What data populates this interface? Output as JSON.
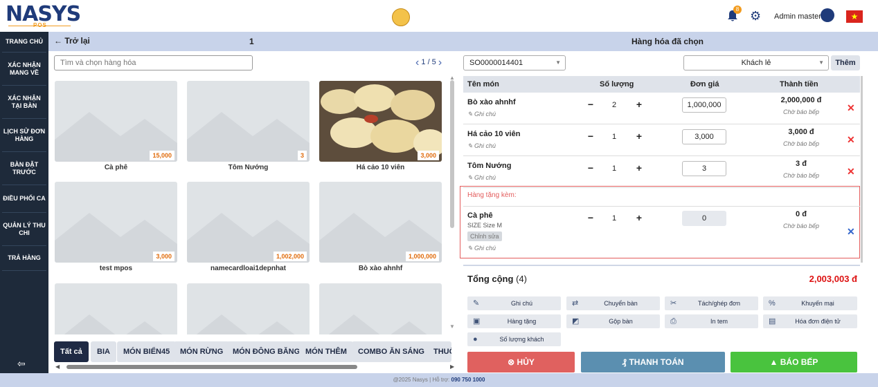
{
  "header": {
    "brand": "NASYS",
    "brand_sub": "POS",
    "notification_count": "8",
    "user_name": "Admin master"
  },
  "sidebar": {
    "items": [
      {
        "label": "TRANG CHỦ"
      },
      {
        "label": "XÁC NHẬN MANG VỀ"
      },
      {
        "label": "XÁC NHẬN TẠI BÀN"
      },
      {
        "label": "LỊCH SỬ ĐƠN HÀNG"
      },
      {
        "label": "BÀN ĐẶT TRƯỚC"
      },
      {
        "label": "ĐIỀU PHỐI CA"
      },
      {
        "label": "QUẢN LÝ THU CHI"
      },
      {
        "label": "TRẢ HÀNG"
      }
    ]
  },
  "left": {
    "back_label": "← Trở lại",
    "table_number": "1",
    "search_placeholder": "Tìm và chọn hàng hóa",
    "pager": "1 / 5"
  },
  "products": [
    {
      "name": "Cà phê",
      "price": "15,000",
      "has_image": false
    },
    {
      "name": "Tôm Nướng",
      "price": "3",
      "has_image": false
    },
    {
      "name": "Há cảo 10 viên",
      "price": "3,000",
      "has_image": true
    },
    {
      "name": "test mpos",
      "price": "3,000",
      "has_image": false
    },
    {
      "name": "namecardloai1depnhat",
      "price": "1,002,000",
      "has_image": false
    },
    {
      "name": "Bò xào ahnhf",
      "price": "1,000,000",
      "has_image": false
    },
    {
      "name": "",
      "price": "",
      "has_image": false
    },
    {
      "name": "",
      "price": "",
      "has_image": false
    },
    {
      "name": "",
      "price": "",
      "has_image": false
    }
  ],
  "categories": [
    {
      "label": "Tất cả",
      "active": true
    },
    {
      "label": "BIA"
    },
    {
      "label": "MÓN BIỂN45"
    },
    {
      "label": "MÓN RỪNG"
    },
    {
      "label": "MÓN ĐÔNG BĂNG"
    },
    {
      "label": "MÓN THÊM"
    },
    {
      "label": "COMBO ĂN SÁNG"
    },
    {
      "label": "THUỐ"
    }
  ],
  "right": {
    "title": "Hàng hóa đã chọn",
    "order_code": "SO0000014401",
    "customer": "Khách lẻ",
    "add_label": "Thêm",
    "columns": {
      "name": "Tên món",
      "qty": "Số lượng",
      "price": "Đơn giá",
      "total": "Thành tiền"
    },
    "note_label": "Ghi chú",
    "status_label": "Chờ báo bếp",
    "items": [
      {
        "name": "Bò xào ahnhf",
        "qty": "2",
        "price": "1,000,000",
        "total": "2,000,000 đ"
      },
      {
        "name": "Há cảo 10 viên",
        "qty": "1",
        "price": "3,000",
        "total": "3,000 đ"
      },
      {
        "name": "Tôm Nướng",
        "qty": "1",
        "price": "3",
        "total": "3 đ"
      }
    ],
    "gift_label": "Hàng tặng kèm:",
    "gift": {
      "name": "Cà phê",
      "size": "SIZE Size M",
      "edit_label": "Chỉnh sửa",
      "qty": "1",
      "price": "0",
      "total": "0 đ"
    },
    "sum_label": "Tổng cộng",
    "sum_count": "(4)",
    "sum_value": "2,003,003 đ",
    "actions": [
      {
        "label": "Ghi chú",
        "icon": "pencil-icon"
      },
      {
        "label": "Chuyển bàn",
        "icon": "swap-icon"
      },
      {
        "label": "Tách/ghép đơn",
        "icon": "scissors-icon"
      },
      {
        "label": "Khuyến mại",
        "icon": "discount-icon"
      },
      {
        "label": "Hàng tặng",
        "icon": "gift-icon"
      },
      {
        "label": "Gộp bàn",
        "icon": "merge-icon"
      },
      {
        "label": "In tem",
        "icon": "printer-icon"
      },
      {
        "label": "Hóa đơn điện tử",
        "icon": "invoice-icon"
      },
      {
        "label": "Số lượng khách",
        "icon": "person-icon"
      }
    ],
    "cancel_label": "HỦY",
    "pay_label": "THANH TOÁN",
    "kitchen_label": "BÁO BẾP"
  },
  "colors": {
    "primary": "#1f3b7a",
    "accent": "#f29b1d",
    "cancel": "#e0615f",
    "pay": "#5b8fb0",
    "kitchen": "#49c33e",
    "danger": "#dd1111"
  },
  "footer": {
    "text": "@2025 Nasys | Hỗ trợ:",
    "phone": "090 750 1000"
  }
}
